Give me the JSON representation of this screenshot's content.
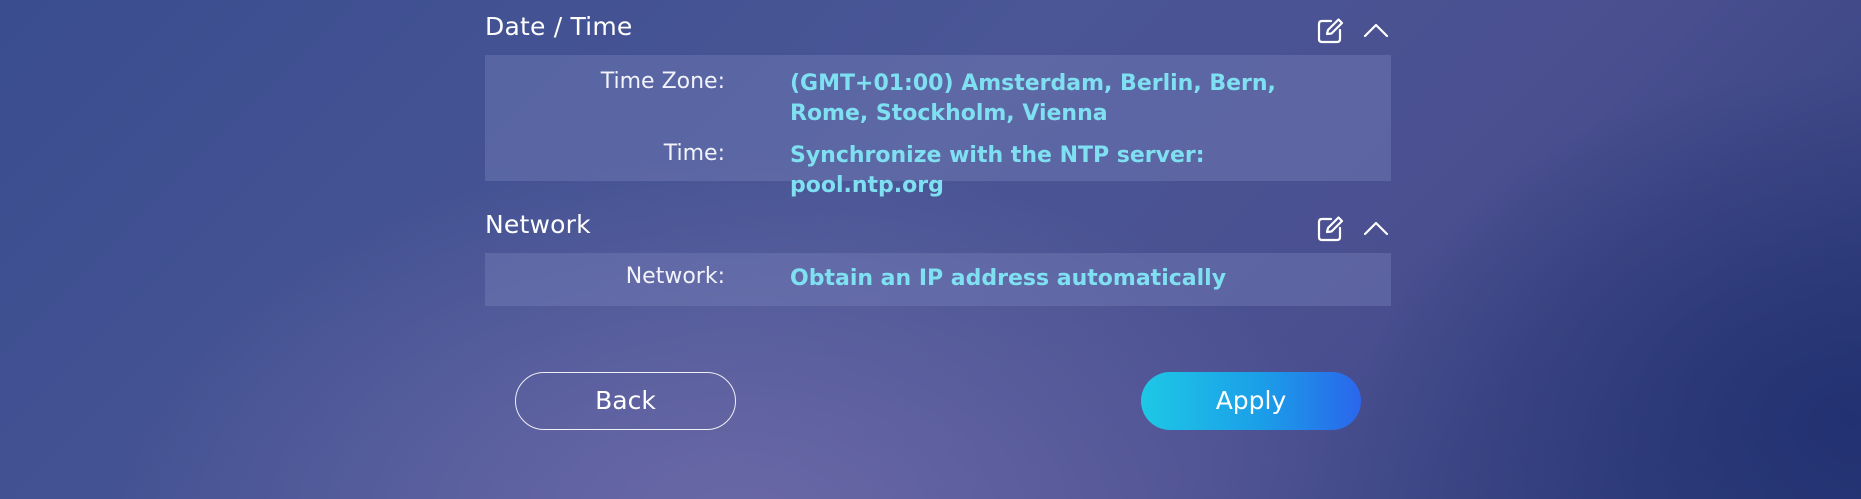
{
  "datetime": {
    "title": "Date / Time",
    "timezone_label": "Time Zone:",
    "timezone_value": "(GMT+01:00) Amsterdam, Berlin, Bern, Rome, Stockholm, Vienna",
    "time_label": "Time:",
    "time_value": "Synchronize with the NTP server: pool.ntp.org"
  },
  "network": {
    "title": "Network",
    "network_label": "Network:",
    "network_value": "Obtain an IP address automatically"
  },
  "buttons": {
    "back_label": "Back",
    "apply_label": "Apply"
  },
  "icons": {
    "edit": "edit-icon",
    "collapse": "chevron-up-icon"
  },
  "colors": {
    "value_text": "#7fe0f2",
    "apply_gradient_start": "#1ec8e6",
    "apply_gradient_end": "#2a66ec"
  }
}
